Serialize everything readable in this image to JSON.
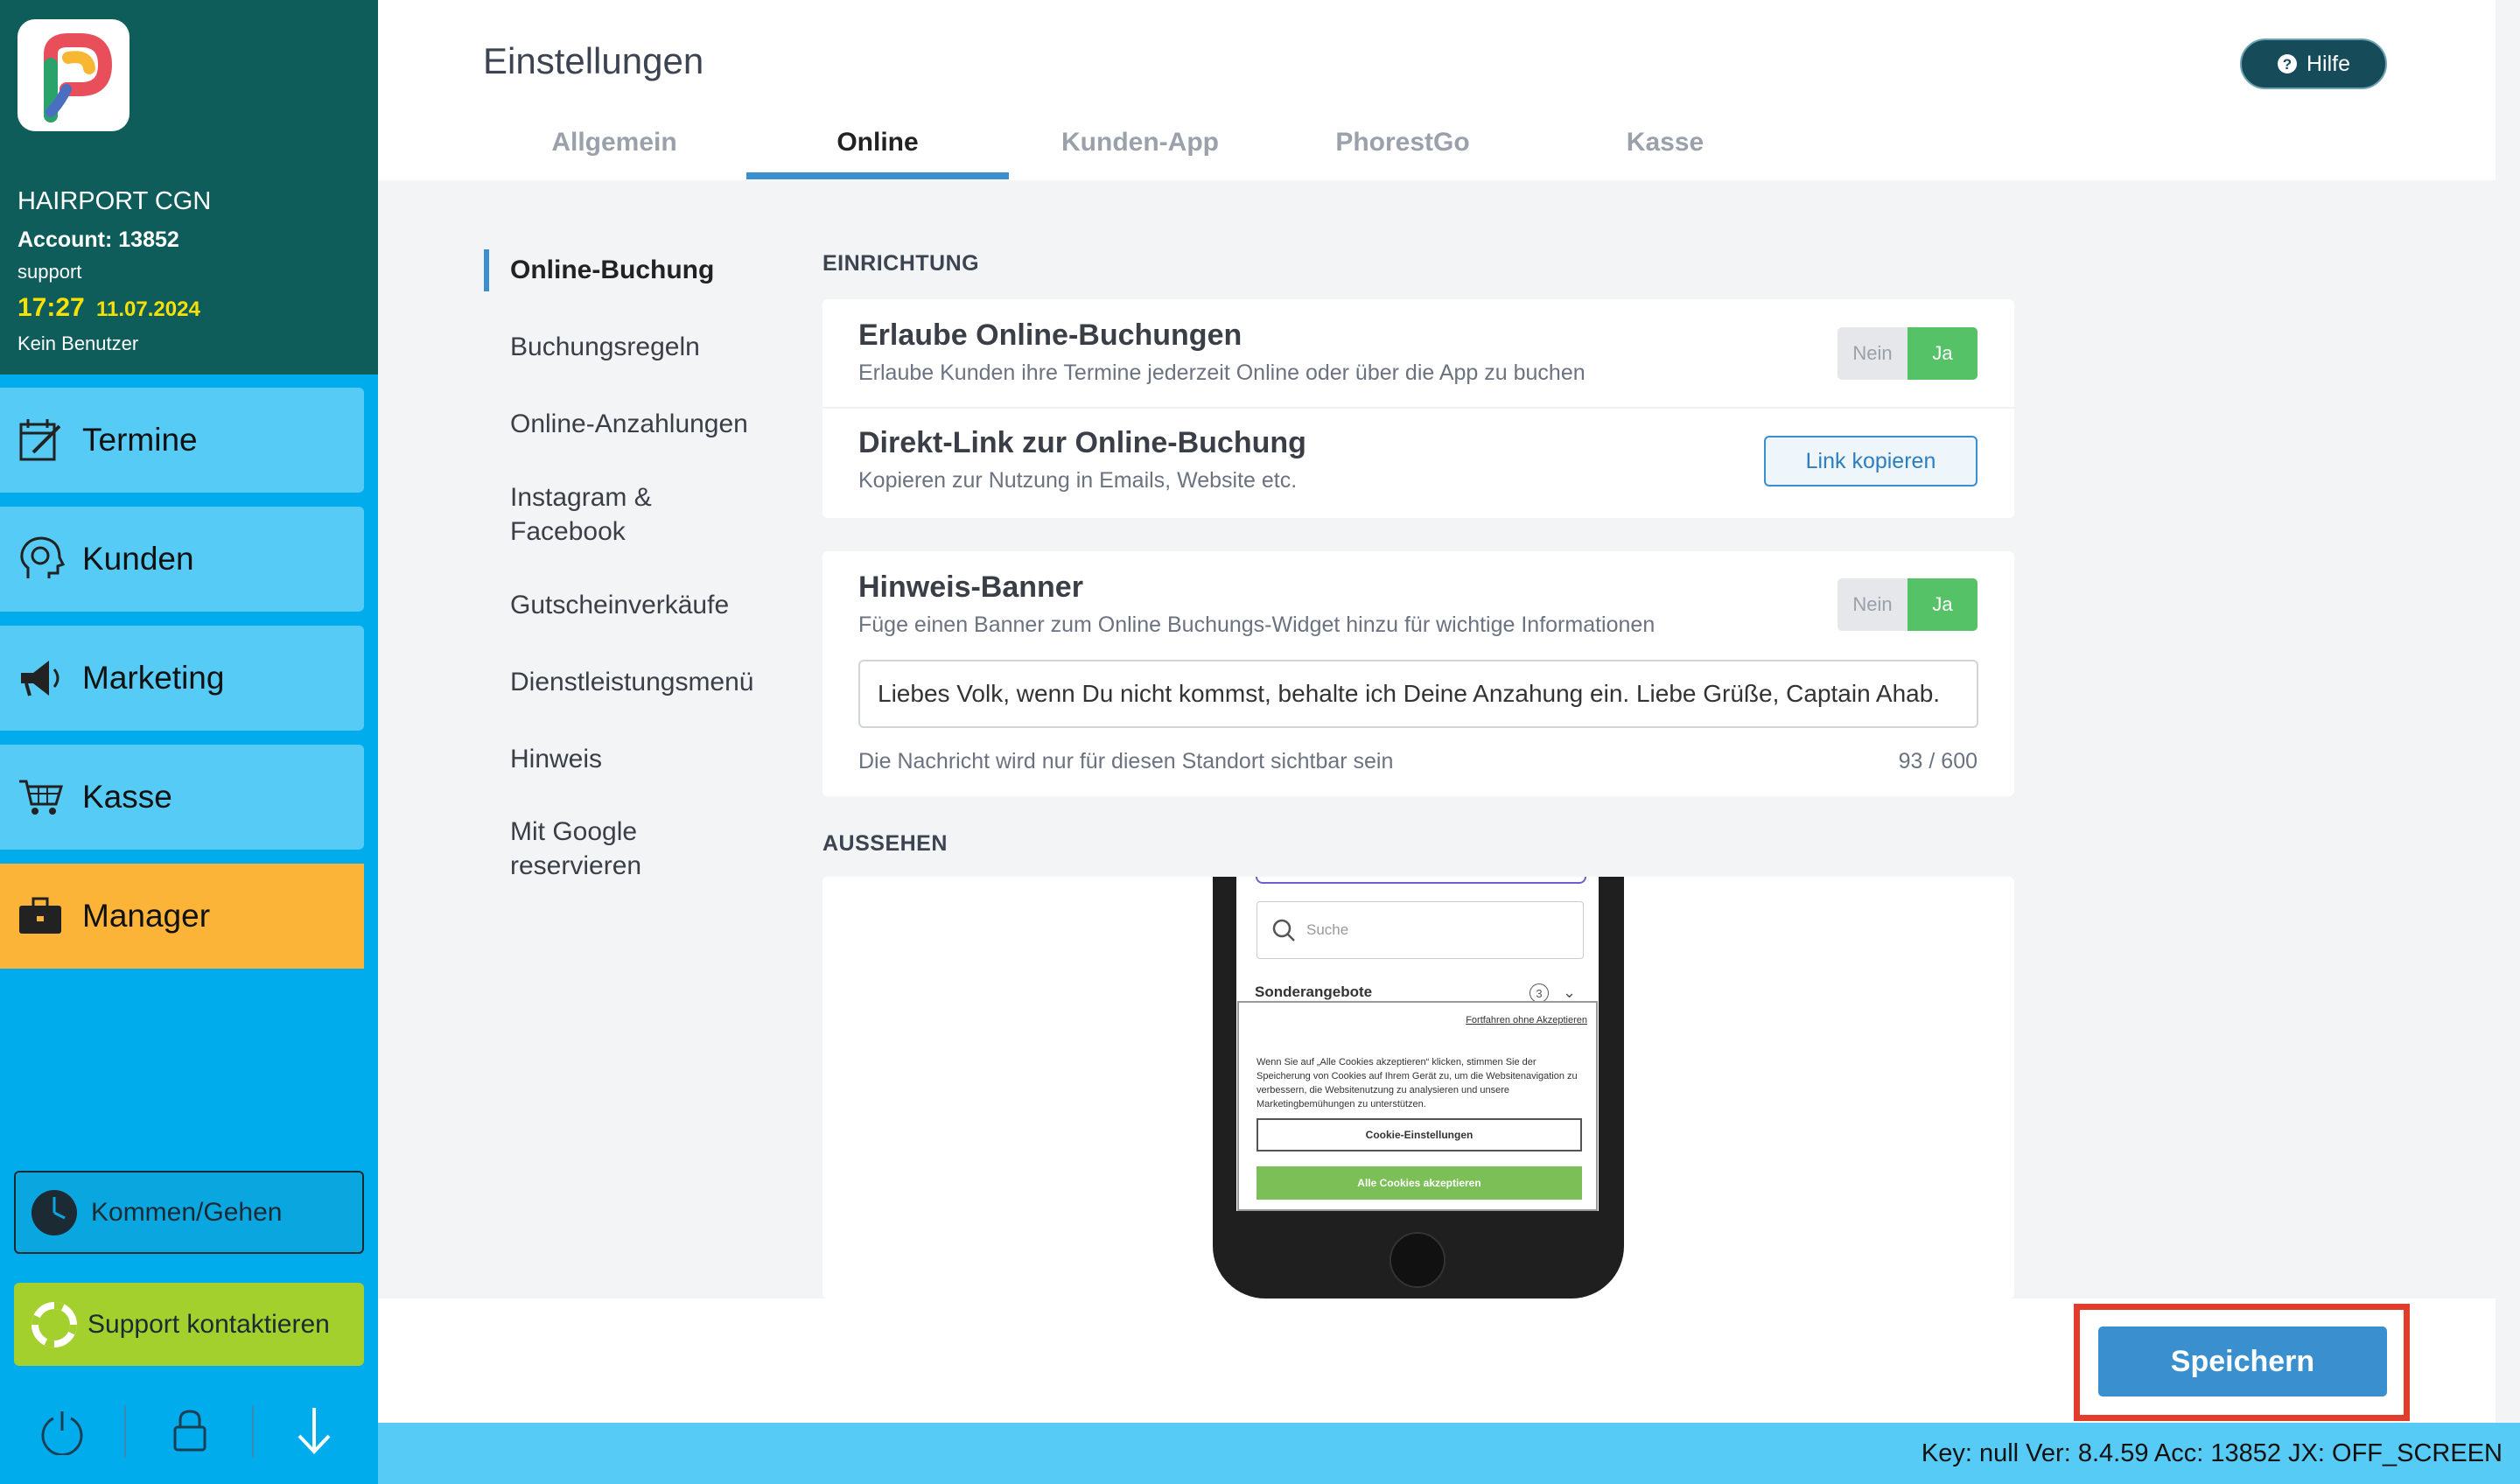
{
  "sidebar": {
    "salon_name": "HAIRPORT CGN",
    "account": "Account: 13852",
    "user_role": "support",
    "time": "17:27",
    "date": "11.07.2024",
    "current_user": "Kein Benutzer",
    "nav": [
      {
        "label": "Termine",
        "icon": "calendar-edit-icon"
      },
      {
        "label": "Kunden",
        "icon": "customer-head-icon"
      },
      {
        "label": "Marketing",
        "icon": "megaphone-icon"
      },
      {
        "label": "Kasse",
        "icon": "cart-icon"
      },
      {
        "label": "Manager",
        "icon": "briefcase-icon"
      }
    ],
    "clock_button": "Kommen/Gehen",
    "support_button": "Support kontaktieren",
    "bottom_icons": [
      "power-icon",
      "lock-icon",
      "arrow-down-icon"
    ]
  },
  "header": {
    "title": "Einstellungen",
    "help_label": "Hilfe",
    "tabs": [
      "Allgemein",
      "Online",
      "Kunden-App",
      "PhorestGo",
      "Kasse"
    ],
    "active_tab": "Online"
  },
  "left_menu": [
    "Online-Buchung",
    "Buchungsregeln",
    "Online-Anzahlungen",
    "Instagram &",
    "Facebook",
    "Gutscheinverkäufe",
    "Dienstleistungsmenü",
    "Hinweis",
    "Mit Google",
    "reservieren"
  ],
  "setup": {
    "section_label": "EINRICHTUNG",
    "allow_online": {
      "title": "Erlaube Online-Buchungen",
      "subtitle": "Erlaube Kunden ihre Termine jederzeit Online oder über die App zu buchen",
      "no": "Nein",
      "yes": "Ja"
    },
    "direct_link": {
      "title": "Direkt-Link zur Online-Buchung",
      "subtitle": "Kopieren zur Nutzung in Emails, Website etc.",
      "button": "Link kopieren"
    },
    "banner": {
      "title": "Hinweis-Banner",
      "subtitle": "Füge einen Banner zum Online Buchungs-Widget hinzu für wichtige Informationen",
      "no": "Nein",
      "yes": "Ja",
      "value": "Liebes Volk, wenn Du nicht kommst, behalte ich Deine Anzahung ein. Liebe Grüße, Captain Ahab.",
      "hint": "Die Nachricht wird nur für diesen Standort sichtbar sein",
      "counter": "93 / 600"
    }
  },
  "appearance": {
    "section_label": "AUSSEHEN",
    "phone": {
      "search_placeholder": "Suche",
      "category": "Sonderangebote",
      "category_count": "3",
      "cookie_skip": "Fortfahren ohne Akzeptieren",
      "cookie_text": "Wenn Sie auf „Alle Cookies akzeptieren“ klicken, stimmen Sie der Speicherung von Cookies auf Ihrem Gerät zu, um die Websitenavigation zu verbessern, die Websitenutzung zu analysieren und unsere Marketingbemühungen zu unterstützen.",
      "cookie_settings": "Cookie-Einstellungen",
      "cookie_accept": "Alle Cookies akzeptieren"
    }
  },
  "footer": {
    "save_label": "Speichern",
    "status": "Key: null Ver: 8.4.59 Acc: 13852  JX: OFF_SCREEN"
  },
  "colors": {
    "sidebar_header": "#0e5d5b",
    "sidebar": "#00aceb",
    "nav_item": "#55cbf5",
    "manager": "#fbb437",
    "support": "#a4d02d",
    "accent": "#3a8fcf",
    "toggle_on": "#55c267",
    "highlight": "#e23d2c"
  }
}
